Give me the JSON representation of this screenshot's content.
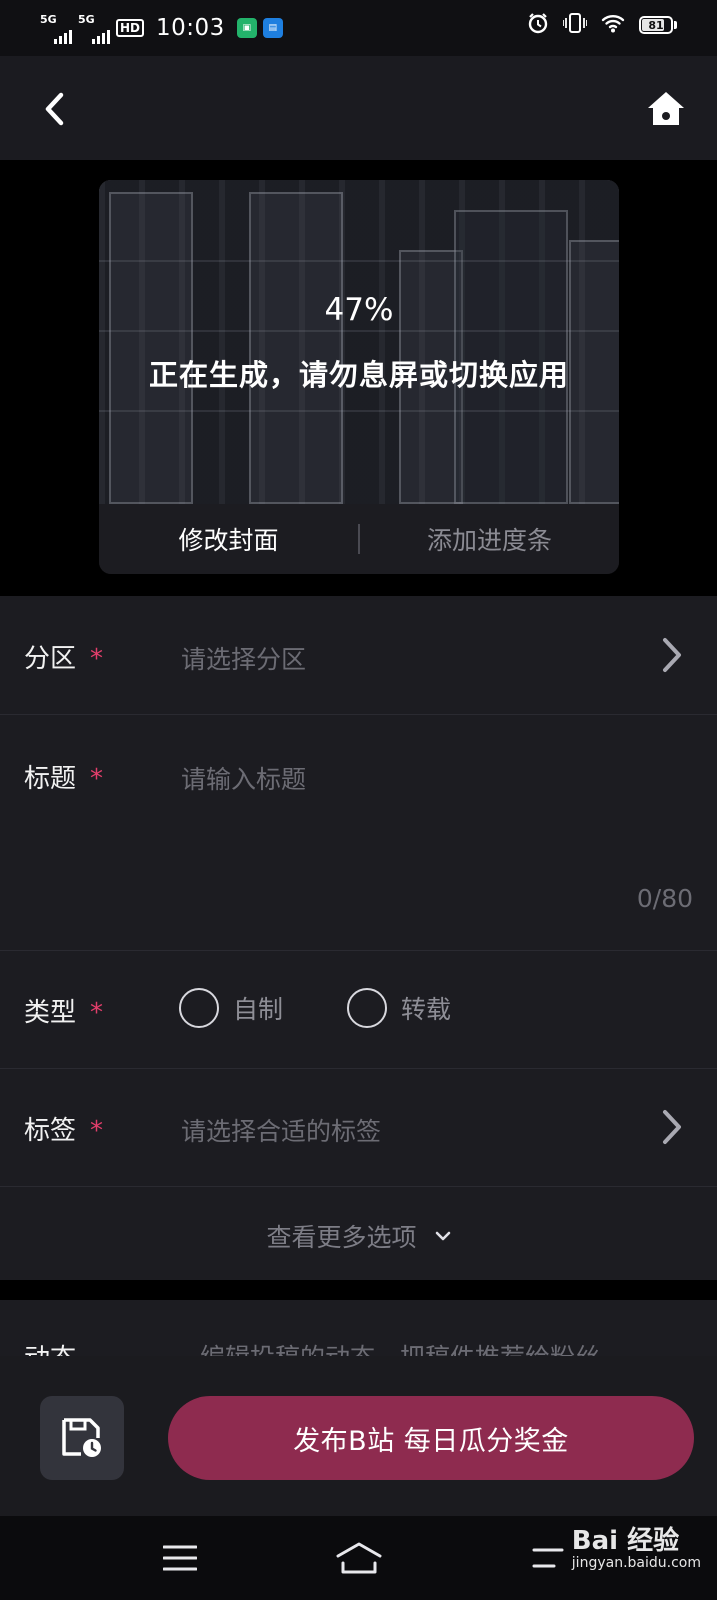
{
  "status_bar": {
    "network1": "5G",
    "network2": "5G",
    "hd": "HD",
    "time": "10:03",
    "battery": 81,
    "icons": [
      "alarm-icon",
      "vibrate-icon",
      "wifi-icon",
      "battery-icon"
    ]
  },
  "nav": {
    "back_icon": "chevron-left-icon",
    "home_icon": "home-icon"
  },
  "preview": {
    "progress": "47%",
    "progress_value": 47,
    "message": "正在生成，请勿息屏或切换应用",
    "edit_cover": "修改封面",
    "add_progress_bar": "添加进度条"
  },
  "form": {
    "partition": {
      "label": "分区",
      "required": "*",
      "placeholder": "请选择分区"
    },
    "title": {
      "label": "标题",
      "required": "*",
      "placeholder": "请输入标题",
      "counter": "0/80"
    },
    "type": {
      "label": "类型",
      "required": "*",
      "options": [
        "自制",
        "转载"
      ]
    },
    "tags": {
      "label": "标签",
      "required": "*",
      "placeholder": "请选择合适的标签"
    },
    "more_options": "查看更多选项"
  },
  "dynamic": {
    "label": "动态",
    "placeholder": "编辑投稿的动态，把稿件推荐给粉丝"
  },
  "actions": {
    "publish": "发布B站 每日瓜分奖金",
    "draft_icon": "save-draft-icon"
  },
  "watermark": {
    "brand": "Bai 经验",
    "site": "jingyan.baidu.com"
  },
  "colors": {
    "accent": "#8e2b4f",
    "required": "#e23e6b",
    "background": "#1c1c21"
  }
}
